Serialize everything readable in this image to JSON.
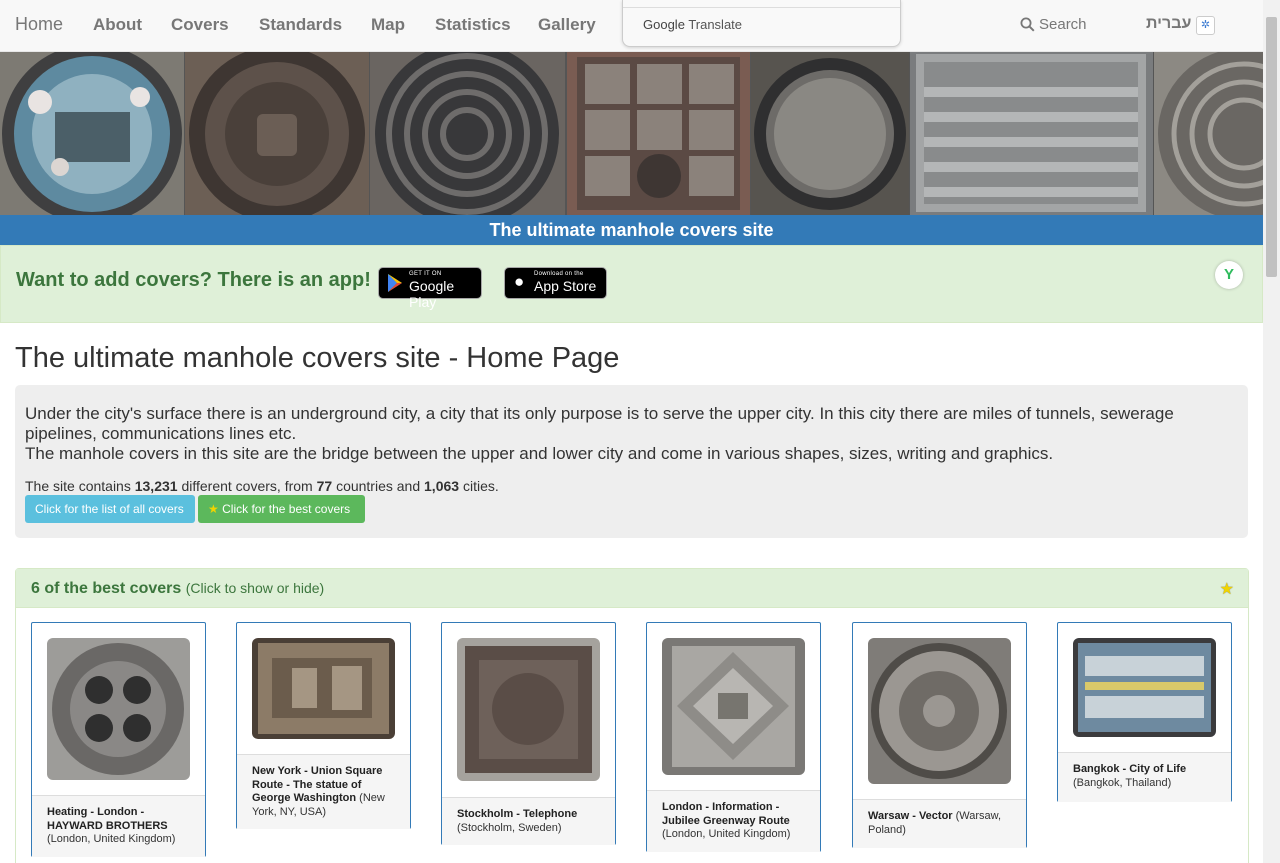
{
  "nav": {
    "brand": "Home",
    "links": [
      "About",
      "Covers",
      "Standards",
      "Map",
      "Statistics",
      "Gallery"
    ],
    "translate_label": "Translate",
    "translate_brand": "Google",
    "search_label": "Search",
    "language": "עברית"
  },
  "banner": {
    "site_title": "The ultimate manhole covers site"
  },
  "app_banner": {
    "text": "Want to add covers? There is an app!",
    "google_play_small": "GET IT ON",
    "google_play_big": "Google Play",
    "app_store_small": "Download on the",
    "app_store_big": "App Store"
  },
  "main": {
    "page_title": "The ultimate manhole covers site - Home Page",
    "intro_line1": "Under the city's surface there is an underground city, a city that its only purpose is to serve the upper city. In this city there are miles of tunnels, sewerage pipelines, communications lines etc.",
    "intro_line2": "The manhole covers in this site are the bridge between the upper and lower city and come in various shapes, sizes, writing and graphics.",
    "stats_prefix": "The site contains",
    "covers_count": "13,231",
    "stats_mid1": "different covers, from",
    "countries_count": "77",
    "stats_mid2": "countries and",
    "cities_count": "1,063",
    "stats_suffix": "cities.",
    "list_button": "Click for the list of all covers",
    "best_button": "Click for the best covers"
  },
  "best_panel": {
    "title": "6 of the best covers",
    "hint": "(Click to show or hide)",
    "cards": [
      {
        "title": "Heating - London - HAYWARD BROTHERS",
        "location": "(London, United Kingdom)"
      },
      {
        "title": "New York - Union Square Route - The statue of George Washington",
        "location": "(New York, NY, USA)"
      },
      {
        "title": "Stockholm - Telephone",
        "location": "(Stockholm, Sweden)"
      },
      {
        "title": "London - Information - Jubilee Greenway Route",
        "location": "(London, United Kingdom)"
      },
      {
        "title": "Warsaw - Vector",
        "location": "(Warsaw, Poland)"
      },
      {
        "title": "Bangkok - City of Life",
        "location": "(Bangkok, Thailand)"
      }
    ]
  },
  "colors": {
    "primary": "#337ab7",
    "success_bg": "#dff0d8",
    "success_text": "#3c763d",
    "info_button": "#5bc0de",
    "success_button": "#5cb85c"
  }
}
